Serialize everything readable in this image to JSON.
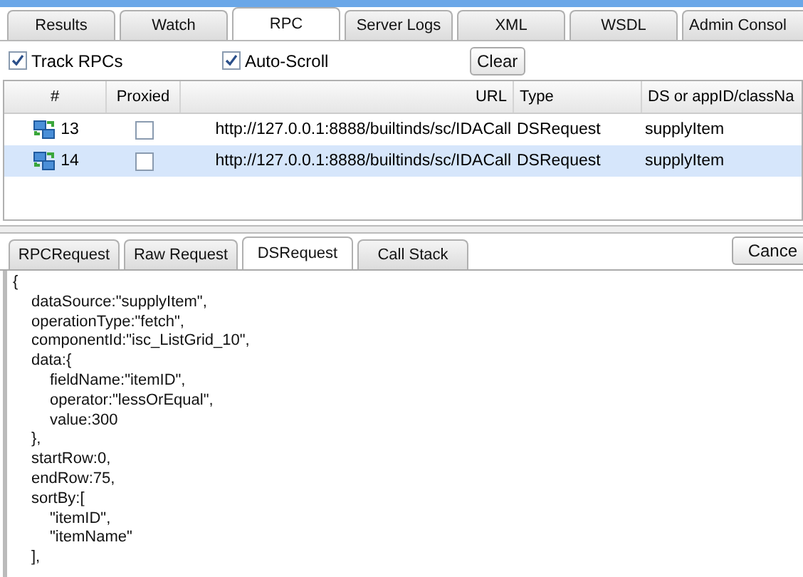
{
  "tabs": [
    {
      "label": "Results",
      "selected": false
    },
    {
      "label": "Watch",
      "selected": false
    },
    {
      "label": "RPC",
      "selected": true
    },
    {
      "label": "Server Logs",
      "selected": false
    },
    {
      "label": "XML",
      "selected": false
    },
    {
      "label": "WSDL",
      "selected": false
    },
    {
      "label": "Admin Consol",
      "selected": false
    }
  ],
  "toolbar": {
    "checkboxes": [
      {
        "label": "Track RPCs",
        "checked": true
      },
      {
        "label": "Auto-Scroll",
        "checked": true
      }
    ],
    "clear_button": "Clear"
  },
  "grid": {
    "columns": [
      "#",
      "Proxied",
      "URL",
      "Type",
      "DS or appID/classNa"
    ],
    "rows": [
      {
        "number": "13",
        "proxied": false,
        "url": "http://127.0.0.1:8888/builtinds/sc/IDACall",
        "type": "DSRequest",
        "ds": "supplyItem",
        "selected": false
      },
      {
        "number": "14",
        "proxied": false,
        "url": "http://127.0.0.1:8888/builtinds/sc/IDACall",
        "type": "DSRequest",
        "ds": "supplyItem",
        "selected": true
      }
    ]
  },
  "detail_tabs": [
    {
      "label": "RPCRequest",
      "selected": false
    },
    {
      "label": "Raw Request",
      "selected": false
    },
    {
      "label": "DSRequest",
      "selected": true
    },
    {
      "label": "Call Stack",
      "selected": false
    }
  ],
  "cancel_button": "Cance",
  "code": [
    {
      "text": "{",
      "children": [
        {
          "text": "dataSource:\"supplyItem\","
        },
        {
          "text": "operationType:\"fetch\","
        },
        {
          "text": "componentId:\"isc_ListGrid_10\","
        },
        {
          "text": "data:{",
          "children": [
            {
              "text": "fieldName:\"itemID\","
            },
            {
              "text": "operator:\"lessOrEqual\","
            },
            {
              "text": "value:300"
            }
          ]
        },
        {
          "text": "},"
        },
        {
          "text": "startRow:0,"
        },
        {
          "text": "endRow:75,"
        },
        {
          "text": "sortBy:[",
          "children": [
            {
              "text": "\"itemID\","
            },
            {
              "text": "\"itemName\""
            }
          ]
        },
        {
          "text": "],"
        }
      ]
    }
  ]
}
